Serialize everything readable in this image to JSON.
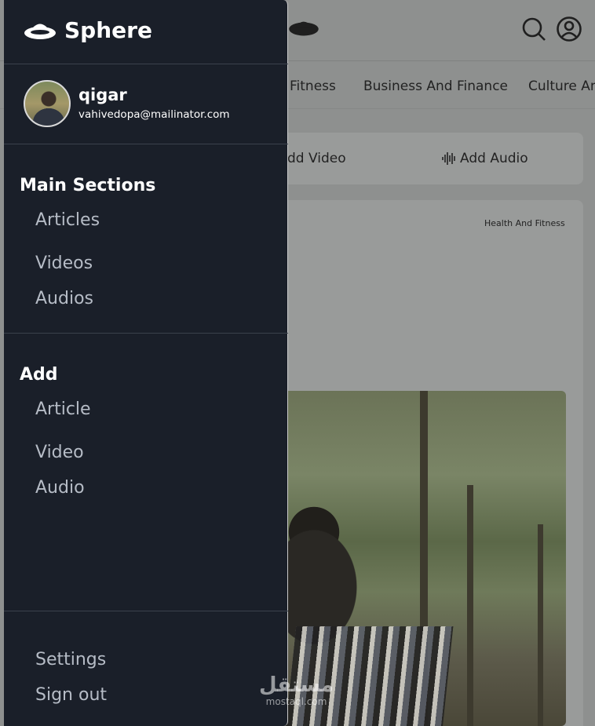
{
  "app": {
    "brand": "Sphere"
  },
  "user": {
    "name": "qigar",
    "email": "vahivedopa@mailinator.com"
  },
  "drawer": {
    "main_sections": {
      "heading": "Main Sections",
      "items": [
        "Articles",
        "Videos",
        "Audios"
      ]
    },
    "add": {
      "heading": "Add",
      "items": [
        "Article",
        "Video",
        "Audio"
      ]
    },
    "footer_items": [
      "Settings",
      "Sign out"
    ]
  },
  "background": {
    "categories": [
      "Fitness",
      "Business And Finance",
      "Culture An"
    ],
    "actions": {
      "add_video": "dd Video",
      "add_audio": "Add Audio"
    },
    "post_tag": "Health And Fitness"
  },
  "watermark": {
    "arabic": "مستقل",
    "latin": "mostaql.com"
  },
  "colors": {
    "drawer_bg": "#1a1f29",
    "nav_text": "#b6bcc6",
    "overlay": "#8e908f"
  }
}
